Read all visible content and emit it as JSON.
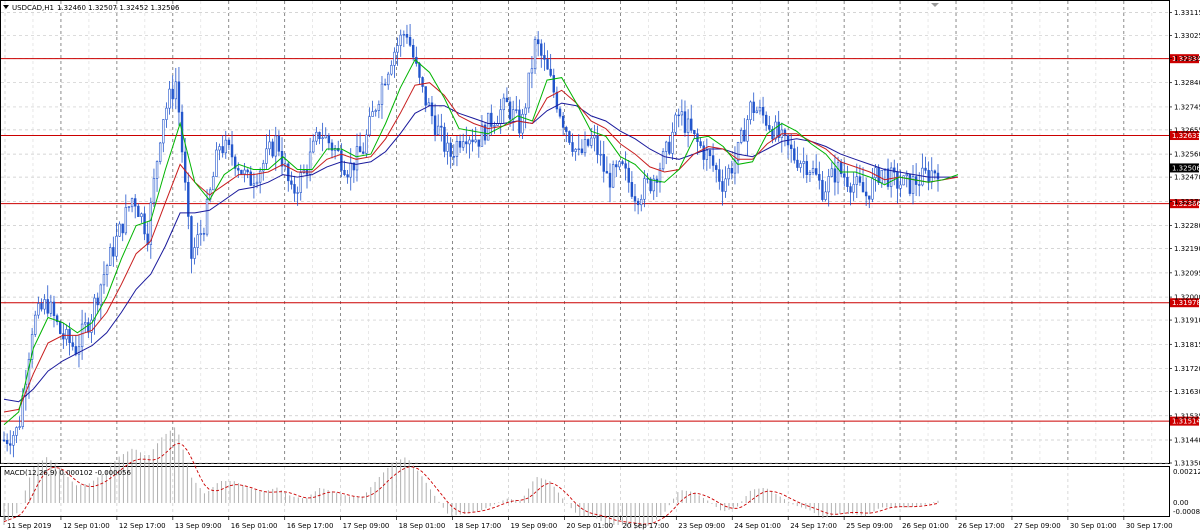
{
  "header": {
    "menu_icon": "triangle-down-icon",
    "symbol": "USDCAD,H1",
    "ohlc": "1.32460 1.32507 1.32452 1.32506"
  },
  "macd": {
    "label": "MACD(12,26,9) 0.000102 -0.000056",
    "scale_top": "0.002121",
    "scale_zero": "0.00",
    "scale_bottom": "-0.000808"
  },
  "colors": {
    "candles": "#2255cc",
    "ma_fast": "#00b400",
    "ma_mid": "#c81e1e",
    "ma_slow": "#1a1a9c",
    "level_line": "#cc0000",
    "price_tag_bg": "#cc0000",
    "current_tag_bg": "#000000",
    "macd_hist": "#b0b0b0",
    "macd_signal": "#cc0000"
  },
  "chart_data": {
    "type": "candlestick",
    "title": "USDCAD,H1",
    "ylim": [
      1.3135,
      1.3316
    ],
    "y_ticks": [
      "1.33115",
      "1.33025",
      "1.32935",
      "1.32840",
      "1.32745",
      "1.32655",
      "1.32560",
      "1.32470",
      "1.32375",
      "1.32280",
      "1.32190",
      "1.32095",
      "1.32000",
      "1.31910",
      "1.31815",
      "1.31720",
      "1.31630",
      "1.31535",
      "1.31440",
      "1.31350"
    ],
    "x_ticks": [
      "11 Sep 2019",
      "12 Sep 01:00",
      "12 Sep 17:00",
      "13 Sep 09:00",
      "16 Sep 01:00",
      "16 Sep 17:00",
      "17 Sep 09:00",
      "18 Sep 01:00",
      "18 Sep 17:00",
      "19 Sep 09:00",
      "20 Sep 01:00",
      "20 Sep 17:00",
      "23 Sep 09:00",
      "24 Sep 01:00",
      "24 Sep 17:00",
      "25 Sep 09:00",
      "26 Sep 01:00",
      "26 Sep 17:00",
      "27 Sep 09:00",
      "30 Sep 01:00",
      "30 Sep 17:00"
    ],
    "horizontal_levels": [
      {
        "value": 1.32934,
        "label": "1.32934"
      },
      {
        "value": 1.32633,
        "label": "1.32633"
      },
      {
        "value": 1.32366,
        "label": "1.32366"
      },
      {
        "value": 1.31978,
        "label": "1.31978"
      },
      {
        "value": 1.31514,
        "label": "1.31514"
      }
    ],
    "current_price": {
      "value": 1.32506,
      "label": "1.32506"
    },
    "close_path": [
      1.3144,
      1.3148,
      1.319,
      1.3198,
      1.3185,
      1.318,
      1.3192,
      1.321,
      1.3225,
      1.324,
      1.3225,
      1.327,
      1.3285,
      1.3215,
      1.323,
      1.326,
      1.3255,
      1.3245,
      1.3252,
      1.3262,
      1.324,
      1.325,
      1.3265,
      1.3258,
      1.325,
      1.3258,
      1.3278,
      1.3295,
      1.3305,
      1.3282,
      1.3268,
      1.3255,
      1.3265,
      1.3262,
      1.327,
      1.3275,
      1.3266,
      1.33,
      1.3285,
      1.3268,
      1.3255,
      1.3262,
      1.3246,
      1.325,
      1.324,
      1.3245,
      1.3255,
      1.3272,
      1.3262,
      1.3255,
      1.3245,
      1.3255,
      1.3275,
      1.327,
      1.3262,
      1.3255,
      1.3252,
      1.3242,
      1.325,
      1.3245,
      1.324,
      1.325,
      1.3245,
      1.3244,
      1.3247,
      1.32506
    ],
    "ma_fast": [
      1.315,
      1.3155,
      1.318,
      1.3192,
      1.319,
      1.3186,
      1.319,
      1.32,
      1.3215,
      1.3228,
      1.323,
      1.325,
      1.3268,
      1.3245,
      1.3238,
      1.3248,
      1.3252,
      1.325,
      1.325,
      1.3255,
      1.325,
      1.325,
      1.3258,
      1.3258,
      1.3255,
      1.3256,
      1.3268,
      1.3282,
      1.3293,
      1.3288,
      1.3278,
      1.3266,
      1.3265,
      1.3264,
      1.3267,
      1.3271,
      1.3269,
      1.3285,
      1.3286,
      1.3276,
      1.3265,
      1.3263,
      1.3255,
      1.3252,
      1.3246,
      1.3245,
      1.325,
      1.3262,
      1.3263,
      1.3259,
      1.3252,
      1.3253,
      1.3264,
      1.3268,
      1.3265,
      1.326,
      1.3256,
      1.3249,
      1.3249,
      1.3247,
      1.3244,
      1.3247,
      1.3246,
      1.3245,
      1.3246,
      1.3248
    ],
    "ma_mid": [
      1.3155,
      1.3156,
      1.317,
      1.3182,
      1.3185,
      1.3185,
      1.3187,
      1.3194,
      1.3205,
      1.3217,
      1.3222,
      1.3237,
      1.3252,
      1.3245,
      1.324,
      1.3244,
      1.3248,
      1.3248,
      1.3249,
      1.3252,
      1.3249,
      1.3249,
      1.3254,
      1.3256,
      1.3254,
      1.3255,
      1.3262,
      1.3272,
      1.3283,
      1.3284,
      1.3279,
      1.3271,
      1.3268,
      1.3266,
      1.3267,
      1.3269,
      1.3268,
      1.3278,
      1.3281,
      1.3276,
      1.3269,
      1.3266,
      1.326,
      1.3256,
      1.3251,
      1.3249,
      1.325,
      1.3256,
      1.3259,
      1.3258,
      1.3254,
      1.3254,
      1.326,
      1.3264,
      1.3264,
      1.3261,
      1.3258,
      1.3253,
      1.3251,
      1.3249,
      1.3246,
      1.3247,
      1.3246,
      1.3245,
      1.3246,
      1.3247
    ],
    "ma_slow": [
      1.316,
      1.3159,
      1.3164,
      1.3171,
      1.3175,
      1.3178,
      1.3181,
      1.3186,
      1.3194,
      1.3203,
      1.3209,
      1.322,
      1.3233,
      1.3233,
      1.3234,
      1.3238,
      1.3242,
      1.3243,
      1.3245,
      1.3248,
      1.3247,
      1.3248,
      1.3251,
      1.3253,
      1.3252,
      1.3253,
      1.3257,
      1.3264,
      1.3272,
      1.3275,
      1.3275,
      1.3272,
      1.327,
      1.3268,
      1.3268,
      1.3269,
      1.3268,
      1.3273,
      1.3276,
      1.3275,
      1.3271,
      1.3269,
      1.3265,
      1.3262,
      1.3258,
      1.3255,
      1.3254,
      1.3256,
      1.3258,
      1.3258,
      1.3256,
      1.3255,
      1.3258,
      1.3261,
      1.3262,
      1.3261,
      1.3259,
      1.3256,
      1.3254,
      1.3252,
      1.325,
      1.3249,
      1.3248,
      1.3247,
      1.3247,
      1.3247
    ]
  }
}
